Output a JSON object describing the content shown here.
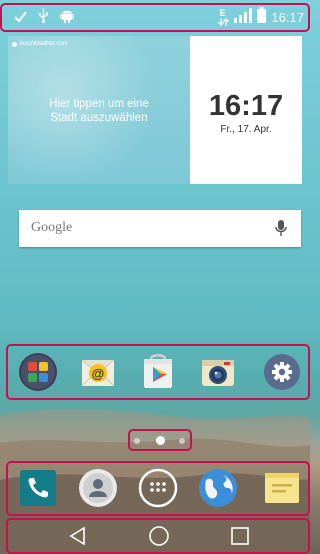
{
  "status_bar": {
    "time": "16:17",
    "network": "E",
    "icons": [
      "check-icon",
      "usb-icon",
      "android-icon",
      "network-type-icon",
      "signal-icon",
      "battery-icon"
    ]
  },
  "weather_widget": {
    "brand": "AccuWeather.com",
    "message_line1": "Hier tippen um eine",
    "message_line2": "Stadt auszuwählen"
  },
  "clock_widget": {
    "time": "16:17",
    "date": "Fr., 17. Apr."
  },
  "search_widget": {
    "label": "Google",
    "mic_icon": "microphone-icon"
  },
  "app_row": [
    "folder-icon",
    "email-icon",
    "play-store-icon",
    "camera-icon",
    "settings-icon"
  ],
  "page_indicator": {
    "pages": 3,
    "current": 2
  },
  "dock": [
    "phone-icon",
    "contacts-icon",
    "apps-drawer-icon",
    "browser-icon",
    "messaging-icon"
  ],
  "nav_bar": [
    "back-icon",
    "home-icon",
    "recents-icon"
  ],
  "colors": {
    "highlight": "#c3124f",
    "clock_text": "#333333"
  }
}
